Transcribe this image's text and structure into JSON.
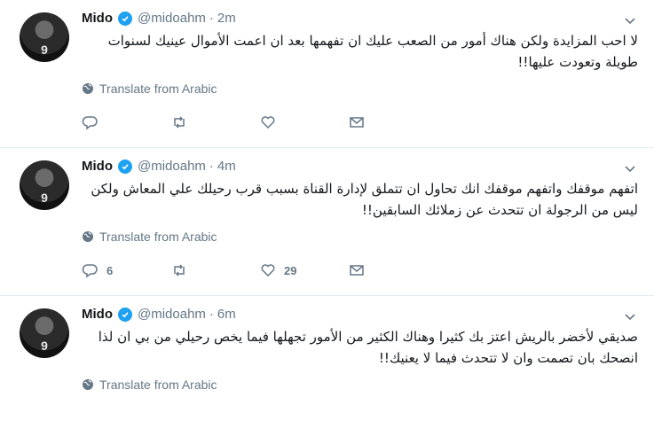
{
  "tweets": [
    {
      "name": "Mido",
      "handle": "@midoahm",
      "separator": "·",
      "time": "2m",
      "text": "لا احب المزايدة ولكن هناك أمور من الصعب عليك ان تفهمها بعد ان اعمت الأموال عينيك لسنوات طويلة وتعودت عليها!!",
      "translate_label": "Translate from Arabic",
      "reply_count": "",
      "retweet_count": "",
      "like_count": "",
      "avatar_number": "9"
    },
    {
      "name": "Mido",
      "handle": "@midoahm",
      "separator": "·",
      "time": "4m",
      "text": "اتفهم موقفك واتفهم موقفك انك تحاول ان تتملق لإدارة القناة بسبب قرب رحيلك علي المعاش ولكن ليس من الرجولة ان تتحدث عن زملائك السابقين!!",
      "translate_label": "Translate from Arabic",
      "reply_count": "6",
      "retweet_count": "",
      "like_count": "29",
      "avatar_number": "9"
    },
    {
      "name": "Mido",
      "handle": "@midoahm",
      "separator": "·",
      "time": "6m",
      "text": "صديقي لأخضر بالريش اعتز بك كثيرا وهناك الكثير من الأمور تجهلها فيما يخص رحيلي من بي ان لذا انصحك بان تصمت وان لا تتحدث فيما لا يعنيك!!",
      "translate_label": "Translate from Arabic",
      "reply_count": "",
      "retweet_count": "",
      "like_count": "",
      "avatar_number": "9"
    }
  ],
  "colors": {
    "verified": "#1da1f2",
    "muted": "#657786",
    "text": "#14171a",
    "divider": "#e6ecf0"
  }
}
